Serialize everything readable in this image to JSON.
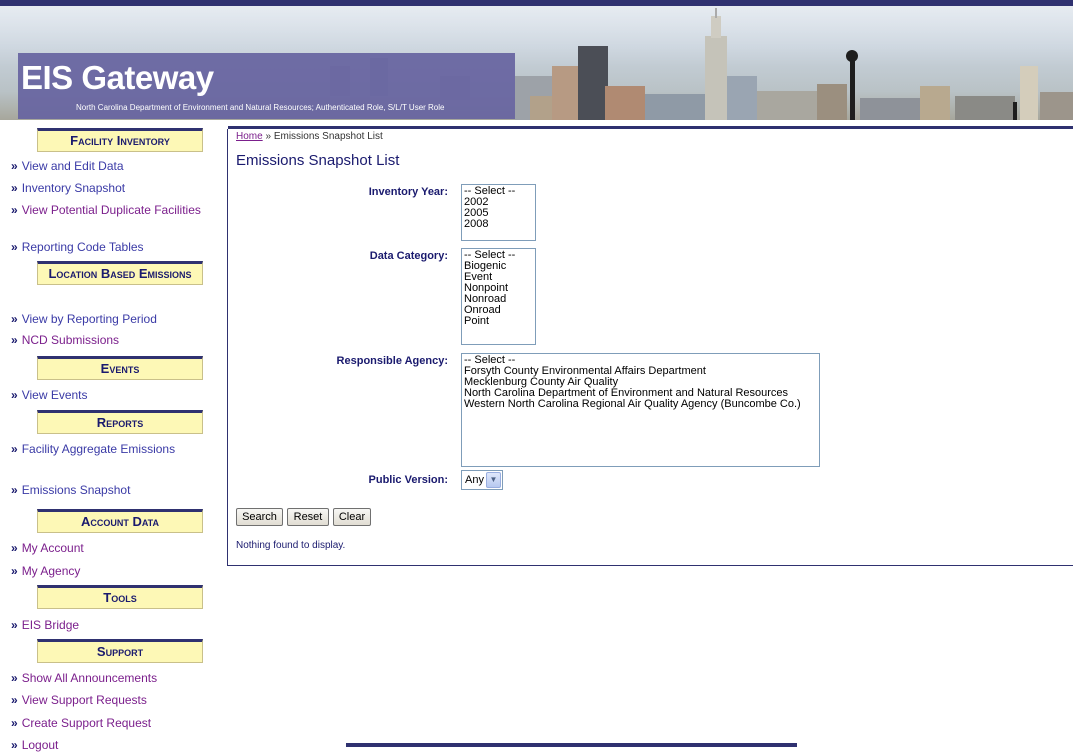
{
  "header": {
    "title": "EIS Gateway",
    "subtitle": "North Carolina Department of Environment and Natural Resources; Authenticated Role, S/L/T User Role"
  },
  "sidebar": {
    "sections": [
      {
        "title": "Facility Inventory",
        "links": [
          "View and Edit Data",
          "Inventory Snapshot",
          "View Potential Duplicate Facilities",
          "Reporting Code Tables"
        ]
      },
      {
        "title": "Location Based Emissions",
        "links": [
          "View by Reporting Period",
          "NCD Submissions"
        ]
      },
      {
        "title": "Events",
        "links": [
          "View Events"
        ]
      },
      {
        "title": "Reports",
        "links": [
          "Facility Aggregate Emissions",
          "Emissions Snapshot"
        ]
      },
      {
        "title": "Account Data",
        "links": [
          "My Account",
          "My Agency"
        ]
      },
      {
        "title": "Tools",
        "links": [
          "EIS Bridge"
        ]
      },
      {
        "title": "Support",
        "links": [
          "Show All Announcements",
          "View Support Requests",
          "Create Support Request",
          "Logout"
        ]
      }
    ],
    "chevron": "»"
  },
  "breadcrumb": {
    "home": "Home",
    "separator": "»",
    "current": "Emissions Snapshot List"
  },
  "page_title": "Emissions Snapshot List",
  "form": {
    "inventory_year": {
      "label": "Inventory Year:",
      "options": [
        "-- Select --",
        "2002",
        "2005",
        "2008"
      ]
    },
    "data_category": {
      "label": "Data Category:",
      "options": [
        "-- Select --",
        "Biogenic",
        "Event",
        "Nonpoint",
        "Nonroad",
        "Onroad",
        "Point"
      ]
    },
    "responsible_agency": {
      "label": "Responsible Agency:",
      "options": [
        "-- Select --",
        "Forsyth County Environmental Affairs Department",
        "Mecklenburg County Air Quality",
        "North Carolina Department of Environment and Natural Resources",
        "Western North Carolina Regional Air Quality Agency (Buncombe Co.)"
      ]
    },
    "public_version": {
      "label": "Public Version:",
      "value": "Any"
    }
  },
  "buttons": {
    "search": "Search",
    "reset": "Reset",
    "clear": "Clear"
  },
  "result_message": "Nothing found to display.",
  "colors": {
    "navy": "#2f3170",
    "sidebar_header_bg": "#fdf8b6",
    "title_box": "#6764a0",
    "visited_link": "#7b1f8c"
  }
}
